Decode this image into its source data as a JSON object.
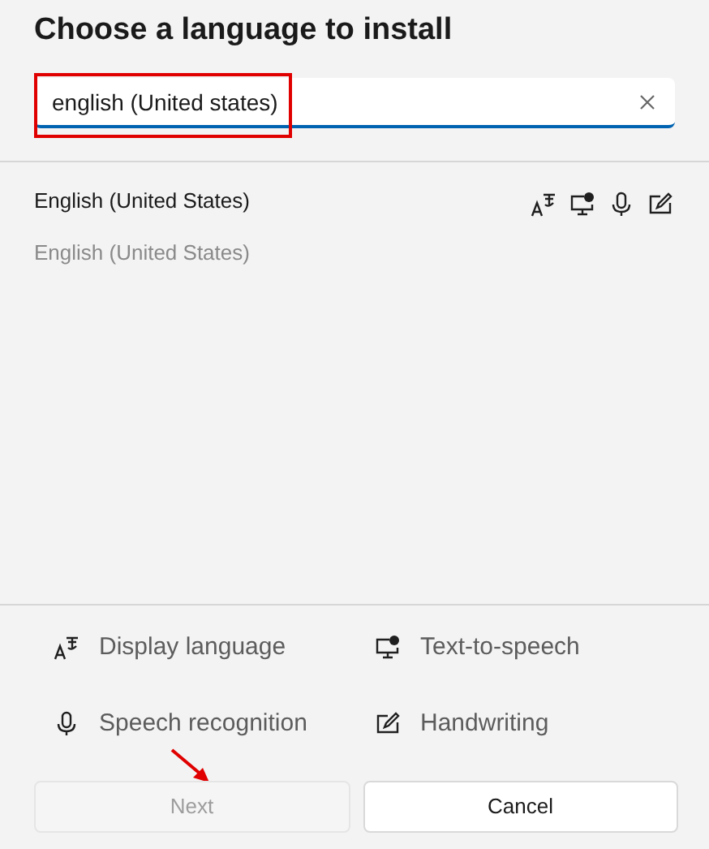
{
  "title": "Choose a language to install",
  "search": {
    "value": "english (United states)"
  },
  "results": [
    {
      "name": "English (United States)",
      "native_name": "English (United States)",
      "selected": false
    }
  ],
  "legend": [
    {
      "label": "Display language"
    },
    {
      "label": "Text-to-speech"
    },
    {
      "label": "Speech recognition"
    },
    {
      "label": "Handwriting"
    }
  ],
  "buttons": [
    {
      "label": "Next",
      "disabled": true
    },
    {
      "label": "Cancel",
      "disabled": false
    }
  ]
}
